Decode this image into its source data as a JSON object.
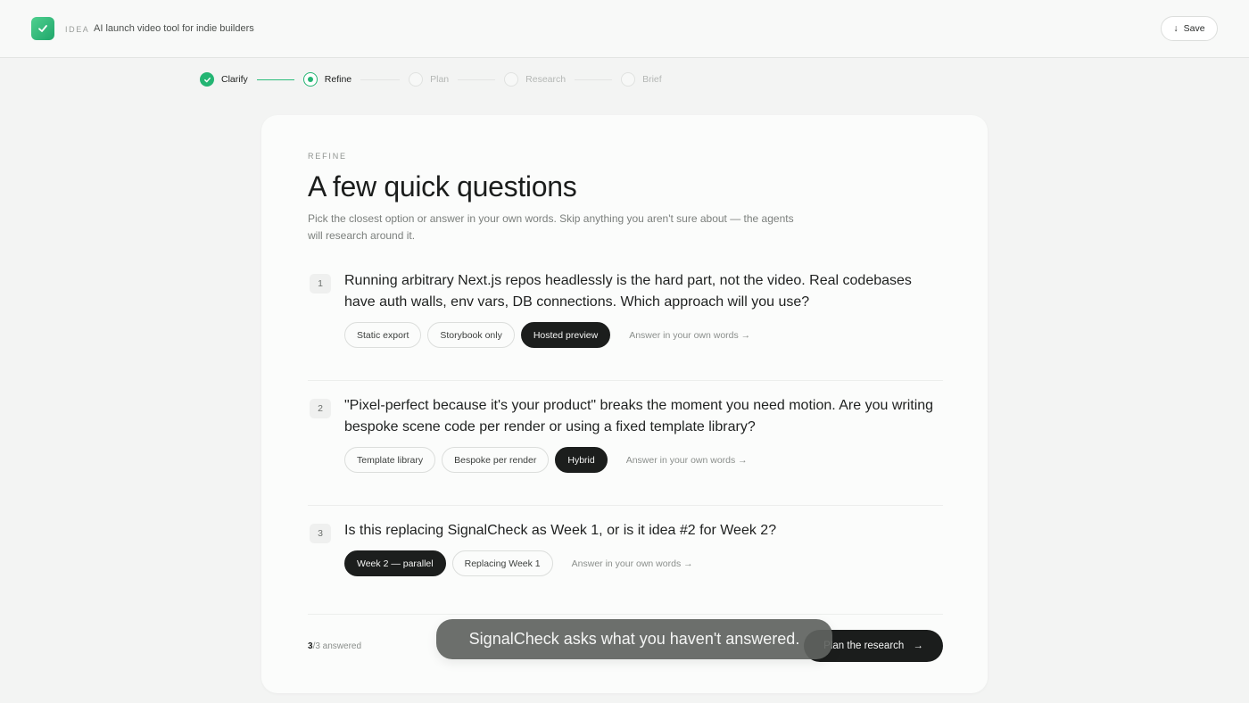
{
  "header": {
    "tag": "IDEA",
    "title": "AI launch video tool for indie builders",
    "save_label": "Save",
    "save_icon": "download-arrow-icon",
    "logo_icon": "check-icon"
  },
  "stepper": {
    "steps": [
      {
        "label": "Clarify",
        "state": "done"
      },
      {
        "label": "Refine",
        "state": "current"
      },
      {
        "label": "Plan",
        "state": "todo"
      },
      {
        "label": "Research",
        "state": "todo"
      },
      {
        "label": "Brief",
        "state": "todo"
      }
    ]
  },
  "card": {
    "eyebrow": "REFINE",
    "headline": "A few quick questions",
    "subtext": "Pick the closest option or answer in your own words. Skip anything you aren't sure about — the agents will research around it."
  },
  "questions": [
    {
      "number": "1",
      "text": "Running arbitrary Next.js repos headlessly is the hard part, not the video. Real codebases have auth walls, env vars, DB connections. Which approach will you use?",
      "options": [
        "Static export",
        "Storybook only",
        "Hosted preview"
      ],
      "selected": "Hosted preview",
      "own_words": "Answer in your own words →"
    },
    {
      "number": "2",
      "text": "\"Pixel-perfect because it's your product\" breaks the moment you need motion. Are you writing bespoke scene code per render or using a fixed template library?",
      "options": [
        "Template library",
        "Bespoke per render",
        "Hybrid"
      ],
      "selected": "Hybrid",
      "own_words": "Answer in your own words →"
    },
    {
      "number": "3",
      "text": "Is this replacing SignalCheck as Week 1, or is it idea #2 for Week 2?",
      "options": [
        "Week 2 — parallel",
        "Replacing Week 1"
      ],
      "selected": "Week 2 — parallel",
      "own_words": "Answer in your own words →"
    }
  ],
  "footer": {
    "answered_count": "3",
    "answered_total": "/3 answered",
    "plan_button": "Plan the research",
    "plan_icon": "arrow-right-icon"
  },
  "toast": {
    "text": "SignalCheck asks what you haven't answered."
  },
  "colors": {
    "accent": "#24b573",
    "selected_chip": "#1c1e1d",
    "page_bg": "#f3f4f3"
  }
}
